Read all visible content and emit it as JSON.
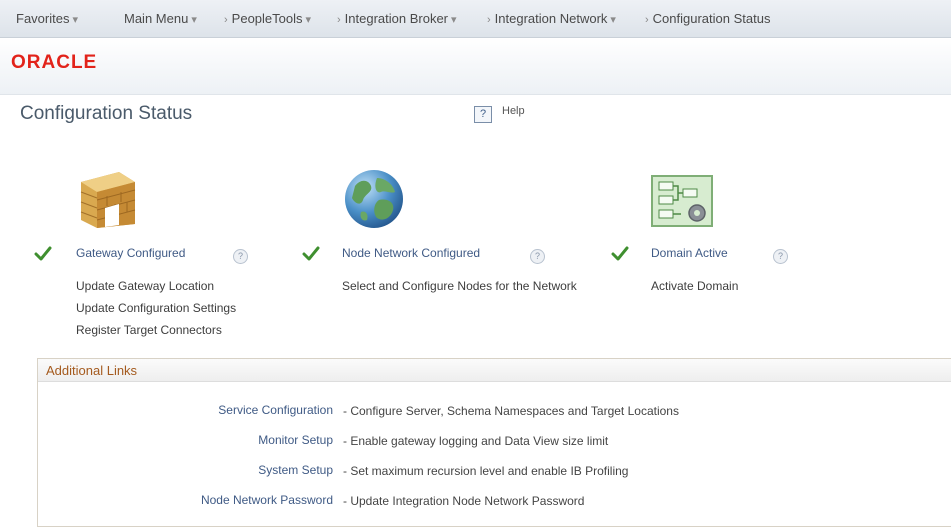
{
  "nav": {
    "favorites": "Favorites",
    "main_menu": "Main Menu",
    "peopletools": "PeopleTools",
    "integration_broker": "Integration Broker",
    "integration_network": "Integration Network",
    "configuration_status": "Configuration Status"
  },
  "brand": {
    "logo_text": "ORACLE",
    "logo_color": "#e2231a"
  },
  "page": {
    "title": "Configuration Status",
    "help_label": "Help",
    "help_icon_glyph": "?"
  },
  "status": {
    "gateway": {
      "title": "Gateway Configured",
      "icon": "firewall-icon",
      "state": "configured",
      "links": [
        "Update Gateway Location",
        "Update Configuration Settings",
        "Register Target Connectors"
      ]
    },
    "node_network": {
      "title": "Node Network Configured",
      "icon": "globe-icon",
      "state": "configured",
      "links": [
        "Select and Configure Nodes for the Network"
      ]
    },
    "domain": {
      "title": "Domain Active",
      "icon": "domain-diagram-icon",
      "state": "active",
      "links": [
        "Activate Domain"
      ]
    }
  },
  "additional_links": {
    "title": "Additional Links",
    "items": [
      {
        "label": "Service Configuration",
        "desc": "- Configure Server, Schema Namespaces and Target Locations"
      },
      {
        "label": "Monitor Setup",
        "desc": "- Enable gateway logging and Data View size limit"
      },
      {
        "label": "System Setup",
        "desc": "- Set maximum recursion level and enable IB Profiling"
      },
      {
        "label": "Node Network Password",
        "desc": "- Update Integration Node Network Password"
      }
    ]
  },
  "colors": {
    "link": "#3f5a85",
    "check": "#3f8f2f",
    "section_title": "#a45a1e"
  }
}
